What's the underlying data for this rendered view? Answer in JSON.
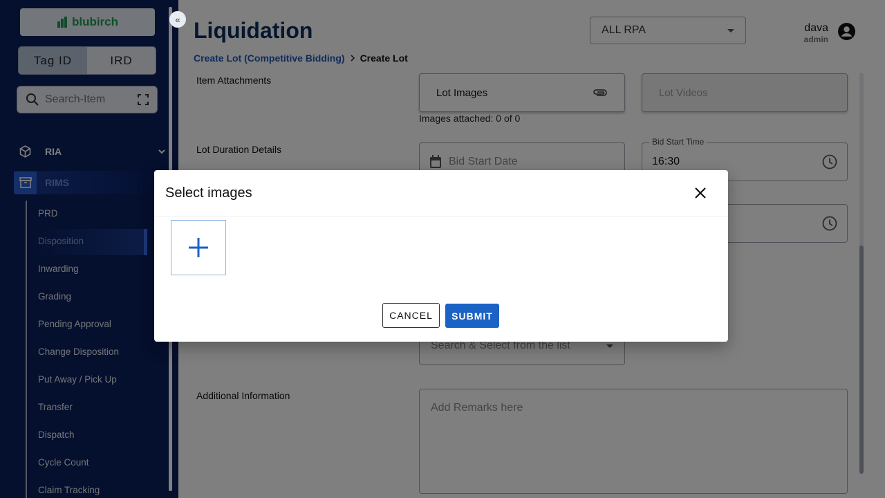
{
  "brand": {
    "name": "blubirch"
  },
  "sidebar": {
    "toggle": [
      "Tag ID",
      "IRD"
    ],
    "search_placeholder": "Search-Item",
    "sections": [
      {
        "label": "RIA",
        "icon": "box-icon"
      },
      {
        "label": "RIMS",
        "icon": "archive-icon"
      }
    ],
    "sub_items": [
      "PRD",
      "Disposition",
      "Inwarding",
      "Grading",
      "Pending Approval",
      "Change Disposition",
      "Put Away / Pick Up",
      "Transfer",
      "Dispatch",
      "Cycle Count",
      "Claim Tracking"
    ],
    "active_item": "Disposition",
    "collapse_glyph": "«"
  },
  "header": {
    "title": "Liquidation",
    "rpa_select": "ALL RPA",
    "user": {
      "name": "dava",
      "role": "admin"
    },
    "breadcrumb": {
      "parent": "Create Lot (Competitive Bidding)",
      "current": "Create Lot"
    }
  },
  "form": {
    "item_attachments_label": "Item Attachments",
    "lot_images_label": "Lot Images",
    "lot_videos_label": "Lot Videos",
    "images_attached": "Images attached: 0 of 0",
    "lot_duration_label": "Lot Duration Details",
    "bid_start_date_placeholder": "Bid Start Date",
    "bid_start_time_label": "Bid Start Time",
    "bid_start_time_value": "16:30",
    "search_select_placeholder": "Search & Select from the list",
    "additional_info_label": "Additional Information",
    "remarks_placeholder": "Add Remarks here"
  },
  "modal": {
    "title": "Select images",
    "add_glyph": "+",
    "cancel_label": "CANCEL",
    "submit_label": "SUBMIT"
  },
  "colors": {
    "sidebar_bg": "#0a1e5c",
    "title_color": "#0a2e5c",
    "primary": "#1a62c4",
    "brand_green": "#1f9a52"
  }
}
